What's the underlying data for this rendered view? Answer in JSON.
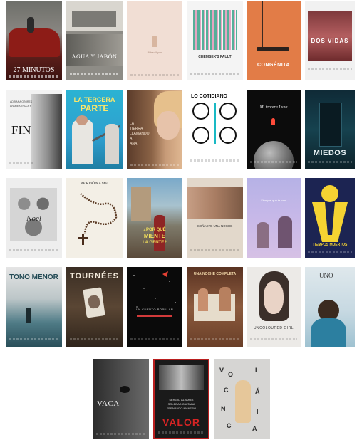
{
  "posters": {
    "p01": {
      "title": "27 MINUTOS"
    },
    "p02": {
      "title": "AGUA Y JABÓN"
    },
    "p03": {
      "title": "Bilbao/Lyon"
    },
    "p04": {
      "title": "CHEMSEX'S FAULT"
    },
    "p05": {
      "title": "CONGÉNITA"
    },
    "p06": {
      "title": "DOS VIDAS"
    },
    "p07": {
      "title": "FIN",
      "cast1": "ADRIANA OZORES",
      "cast2": "ANDREA TRUCKY"
    },
    "p08": {
      "title_line1": "LA TERCERA",
      "title_line2": "PARTE"
    },
    "p09": {
      "title_line1": "LA",
      "title_line2": "TIERRA",
      "title_line3": "LLAMANDO",
      "title_line4": "A",
      "title_line5": "ANA"
    },
    "p10": {
      "title": "LO COTIDIANO"
    },
    "p11": {
      "title": "Mi tercera Luna"
    },
    "p12": {
      "title": "MIEDOS"
    },
    "p13": {
      "title": "Noel"
    },
    "p14": {
      "title": "PERDÓNAME"
    },
    "p15": {
      "title_line1": "¿POR QUÉ",
      "title_line2": "MIENTE",
      "title_line3": "LA GENTE?"
    },
    "p16": {
      "title": "SOÑASTE UNA NOCHE"
    },
    "p17": {
      "title": "Siempre que te miro"
    },
    "p18": {
      "title": "TIEMPOS MUERTOS"
    },
    "p19": {
      "title": "TONO MENOR"
    },
    "p20": {
      "title": "TOURNÉES"
    },
    "p21": {
      "title": "UN CUENTO POPULAR"
    },
    "p22": {
      "title": "UNA NOCHE COMPLETA"
    },
    "p23": {
      "title": "UNCOLOURED GIRL"
    },
    "p24": {
      "title": "UNO"
    },
    "p25": {
      "title": "VACA"
    },
    "p26": {
      "cast1": "SERGIO ÁLVAREZ",
      "cast2": "SOLEDAD CALTABA",
      "cast3": "FERNANDO MANERO",
      "title": "VALOR"
    },
    "p27": {
      "title": "VOLCÁNICA",
      "letters": [
        "V",
        "O",
        "L",
        "C",
        "Á",
        "N",
        "I",
        "C",
        "A"
      ]
    }
  }
}
